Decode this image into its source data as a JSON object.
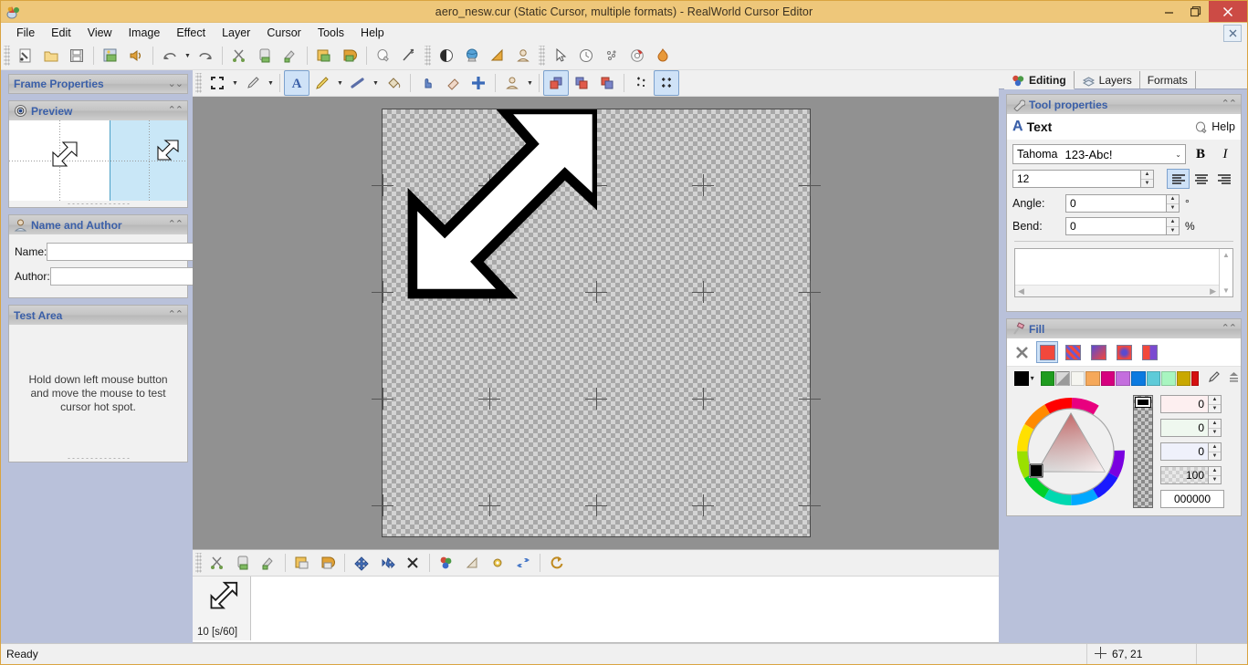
{
  "window": {
    "title": "aero_nesw.cur (Static Cursor, multiple formats) - RealWorld Cursor Editor",
    "app_icon": "app-logo-icon",
    "minimize": "–",
    "maximize": "❐",
    "close": "✕",
    "doc_close": "✕"
  },
  "menubar": {
    "items": [
      {
        "label": "File"
      },
      {
        "label": "Edit"
      },
      {
        "label": "View"
      },
      {
        "label": "Image"
      },
      {
        "label": "Effect"
      },
      {
        "label": "Layer"
      },
      {
        "label": "Cursor"
      },
      {
        "label": "Tools"
      },
      {
        "label": "Help"
      }
    ]
  },
  "toolbar_main": {
    "groups": [
      {
        "buttons": [
          {
            "icon": "new-document-icon"
          },
          {
            "icon": "open-folder-icon"
          },
          {
            "icon": "save-disk-icon"
          }
        ]
      },
      {
        "buttons": [
          {
            "icon": "save-image-icon"
          },
          {
            "icon": "sound-icon"
          }
        ]
      },
      {
        "buttons": [
          {
            "icon": "undo-icon",
            "has_dropdown": true
          },
          {
            "icon": "redo-icon"
          }
        ]
      },
      {
        "buttons": [
          {
            "icon": "cut-scissors-icon"
          },
          {
            "icon": "copy-icon"
          },
          {
            "icon": "paste-brush-icon"
          }
        ]
      },
      {
        "buttons": [
          {
            "icon": "import-image-icon"
          },
          {
            "icon": "export-image-icon"
          }
        ]
      },
      {
        "buttons": [
          {
            "icon": "lightbulb-icon"
          },
          {
            "icon": "magic-wand-icon"
          }
        ]
      },
      {
        "buttons": [
          {
            "icon": "contrast-sphere-icon"
          },
          {
            "icon": "globe-icon"
          },
          {
            "icon": "gradient-triangle-icon"
          },
          {
            "icon": "avatar-icon"
          }
        ]
      },
      {
        "buttons": [
          {
            "icon": "arrow-pointer-icon"
          },
          {
            "icon": "clock-icon"
          },
          {
            "icon": "sparkle-icon"
          },
          {
            "icon": "lifebuoy-icon"
          },
          {
            "icon": "flame-icon"
          }
        ]
      }
    ]
  },
  "toolbar_tools": {
    "buttons": [
      {
        "icon": "selection-rect-icon",
        "selected": false,
        "has_dropdown": true
      },
      {
        "icon": "eyedropper-pen-icon",
        "selected": false,
        "has_dropdown": true
      },
      {
        "icon": "text-tool-icon",
        "selected": true
      },
      {
        "icon": "pencil-icon",
        "selected": false,
        "has_dropdown": true
      },
      {
        "icon": "line-tool-icon",
        "selected": false,
        "has_dropdown": true
      },
      {
        "icon": "paint-bucket-icon",
        "selected": false
      },
      {
        "icon": "hand-pointer-icon",
        "selected": false
      },
      {
        "icon": "eraser-icon",
        "selected": false
      },
      {
        "icon": "hotspot-crosshair-icon",
        "selected": false
      },
      {
        "icon": "avatar-tool-icon",
        "selected": false,
        "has_dropdown": true
      },
      {
        "icon": "layers-front-icon",
        "selected": true
      },
      {
        "icon": "layers-middle-icon",
        "selected": false
      },
      {
        "icon": "layers-back-icon",
        "selected": false
      },
      {
        "icon": "snap-small-icon",
        "selected": false
      },
      {
        "icon": "snap-grid-icon",
        "selected": true
      }
    ]
  },
  "left_panel": {
    "frame_properties": {
      "title": "Frame Properties",
      "collapsed": true,
      "chevron": "⌄⌄"
    },
    "preview": {
      "title": "Preview",
      "icon": "eye-icon",
      "chevron": "⌃⌃"
    },
    "name_and_author": {
      "title": "Name and Author",
      "icon": "person-icon",
      "chevron": "⌃⌃",
      "name_label": "Name:",
      "name_value": "",
      "author_label": "Author:",
      "author_value": ""
    },
    "test_area": {
      "title": "Test Area",
      "chevron": "⌃⌃",
      "hint": "Hold down left mouse button and move the mouse to test cursor hot spot."
    }
  },
  "canvas": {
    "cursor_name": "aero-nesw-diagonal-resize-cursor",
    "transparency": "checkerboard"
  },
  "bottom_toolbar": {
    "buttons": [
      {
        "icon": "cut-scissors-icon"
      },
      {
        "icon": "copy-frame-icon"
      },
      {
        "icon": "paste-frame-icon"
      },
      {
        "icon": "add-frame-icon"
      },
      {
        "icon": "duplicate-frame-icon"
      },
      {
        "icon": "move-frame-left-icon"
      },
      {
        "icon": "move-frame-right-icon"
      },
      {
        "icon": "delete-frame-icon"
      },
      {
        "icon": "frame-colors-icon"
      },
      {
        "icon": "frame-ramp-icon"
      },
      {
        "icon": "frame-settings-icon"
      },
      {
        "icon": "frame-swap-icon"
      },
      {
        "icon": "frame-loop-icon"
      }
    ]
  },
  "frame_strip": {
    "frames": [
      {
        "label": "10 [s/60]",
        "icon": "diagonal-arrow-thumb-icon",
        "selected": true
      }
    ]
  },
  "right_panel": {
    "tabs": [
      {
        "label": "Editing",
        "icon": "editing-tab-icon",
        "active": true
      },
      {
        "label": "Layers",
        "icon": "layers-tab-icon",
        "active": false
      },
      {
        "label": "Formats",
        "icon": "formats-tab-icon",
        "active": false
      }
    ],
    "tool_properties": {
      "title": "Tool properties",
      "icon": "wrench-icon",
      "chevron": "⌃⌃",
      "tool_name": "Text",
      "tool_icon": "text-A-icon",
      "help_label": "Help",
      "help_icon": "lightbulb-icon",
      "font_name": "Tahoma",
      "font_sample": "123-Abc!",
      "font_chevron": "⌄",
      "bold_label": "B",
      "italic_label": "I",
      "font_size": "12",
      "align_options": [
        "align-left",
        "align-center",
        "align-right"
      ],
      "align_selected": "align-left",
      "angle_label": "Angle:",
      "angle_value": "0",
      "angle_unit": "°",
      "bend_label": "Bend:",
      "bend_value": "0",
      "bend_unit": "%",
      "text_value": ""
    },
    "fill": {
      "title": "Fill",
      "icon": "paint-roller-icon",
      "chevron": "⌃⌃",
      "types": [
        {
          "name": "no-fill",
          "selected": false
        },
        {
          "name": "solid-fill",
          "selected": true
        },
        {
          "name": "hatch-fill",
          "selected": false
        },
        {
          "name": "linear-gradient-fill",
          "selected": false
        },
        {
          "name": "radial-gradient-fill",
          "selected": false
        },
        {
          "name": "two-color-fill",
          "selected": false
        }
      ],
      "palette": [
        "#000000",
        "#1f9c1f",
        "#b0b0b0",
        "#f5f5f0",
        "#f5a85a",
        "#d6007f",
        "#c46ede",
        "#0b7ae0",
        "#5ecbd8",
        "#a8f5c0",
        "#c9a800",
        "#d41010"
      ],
      "palette_dropdown": "▾",
      "eyedropper_icon": "eyedropper-icon",
      "palette_manage_icon": "palette-manage-icon",
      "channels": [
        {
          "name": "red",
          "value": "0",
          "tint": "#fdeff0"
        },
        {
          "name": "green",
          "value": "0",
          "tint": "#eff8ef"
        },
        {
          "name": "blue",
          "value": "0",
          "tint": "#eff1fb"
        },
        {
          "name": "alpha",
          "value": "100",
          "tint": "checker"
        }
      ],
      "hex_value": "000000",
      "selected_color": "#000000"
    }
  },
  "statusbar": {
    "status": "Ready",
    "coords_icon": "crosshair-icon",
    "coords": "67, 21"
  }
}
